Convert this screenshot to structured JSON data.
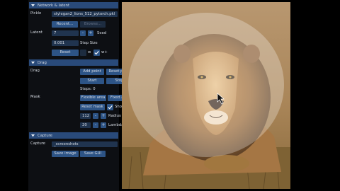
{
  "network": {
    "title": "Network & latent",
    "pickle_label": "Pickle",
    "pickle_value": "stylegan2_lions_512_pytorch.pkl",
    "recent_label": "Recent...",
    "browse_label": "Browse...",
    "latent_label": "Latent",
    "latent_value": "7",
    "minus": "-",
    "plus": "+",
    "seed_label": "Seed",
    "step_value": "0.001",
    "step_label": "Step Size",
    "reset_label": "Reset",
    "w_label": "w",
    "wplus_label": "w+"
  },
  "drag": {
    "title": "Drag",
    "drag_label": "Drag",
    "add_point": "Add point",
    "reset_point": "Reset point",
    "start": "Start",
    "stop": "Stop",
    "steps": "Steps: 0",
    "mask_label": "Mask",
    "flexible_area": "Flexible area",
    "fixed_area": "Fixed area",
    "reset_mask": "Reset mask",
    "show_mask": "Show mask",
    "radius_value": "112",
    "radius_label": "Radius",
    "lambda_value": "20",
    "lambda_label": "Lambda",
    "minus": "-",
    "plus": "+"
  },
  "capture": {
    "title": "Capture",
    "capture_label": "Capture",
    "path_value": "_screenshots",
    "save_image": "Save image",
    "save_gui": "Save GUI"
  },
  "colors": {
    "panel_bg": "#0d0f13",
    "header": "#294a7a",
    "button": "#2d5486",
    "field": "#20344f"
  }
}
